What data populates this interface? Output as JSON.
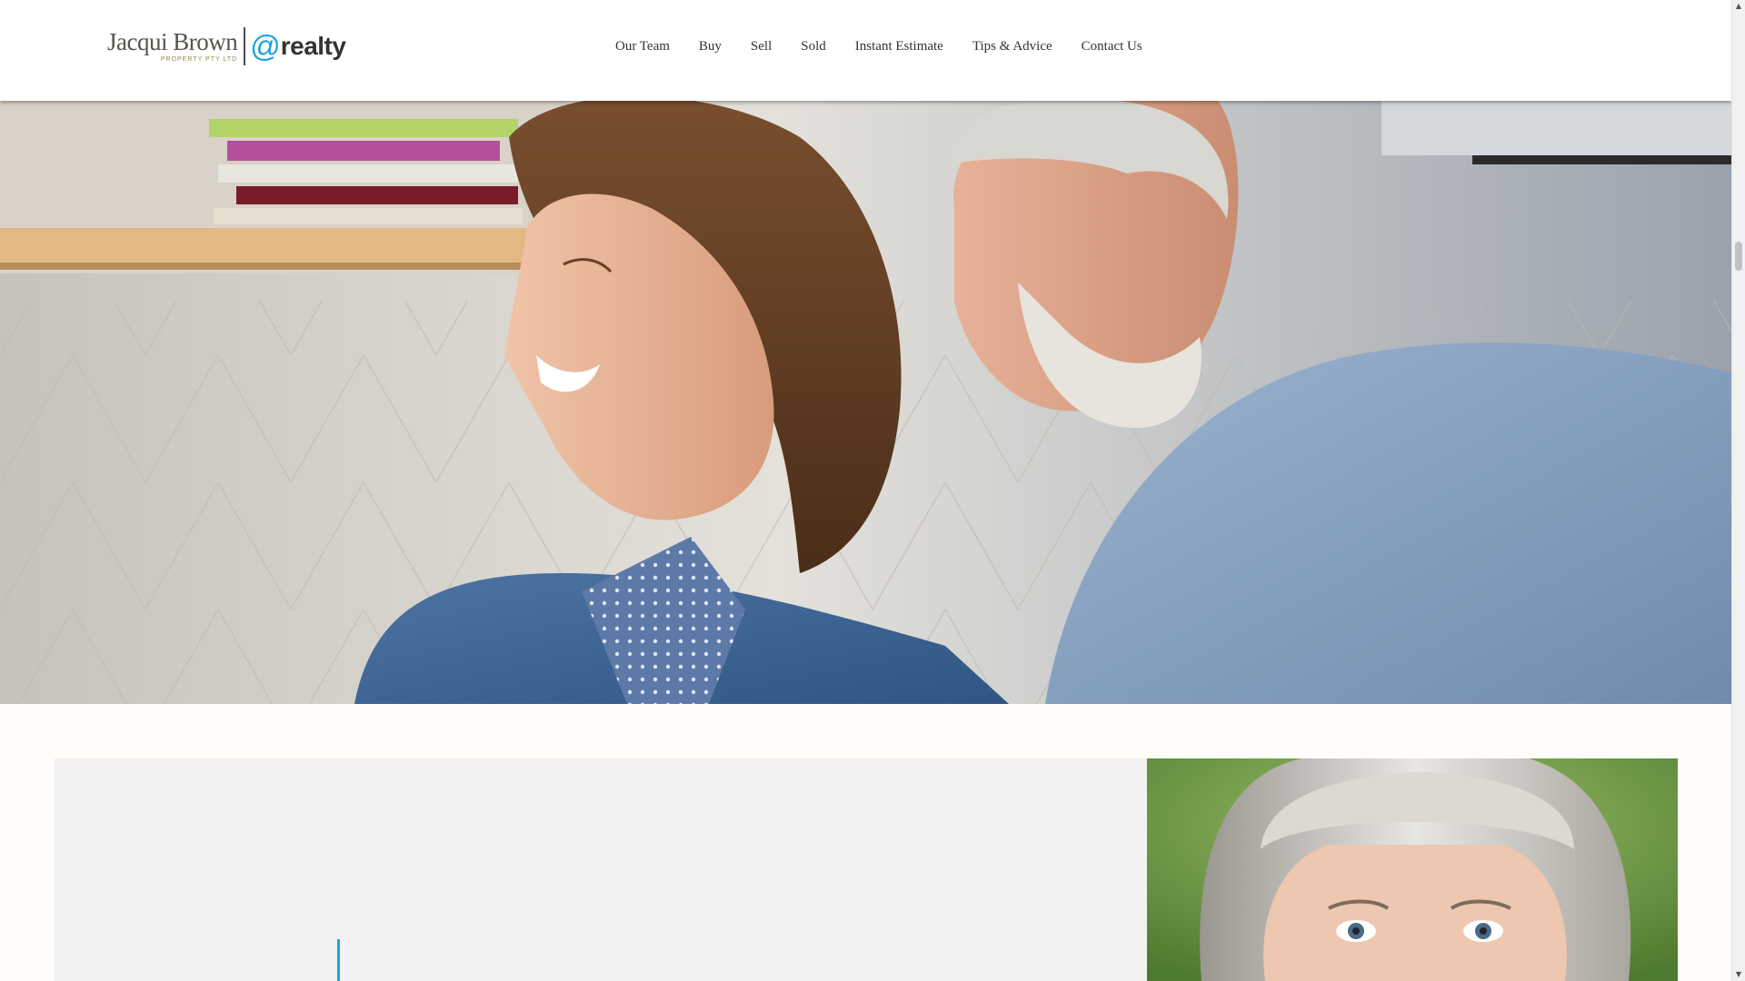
{
  "header": {
    "logo": {
      "name": "Jacqui Brown",
      "subtitle": "PROPERTY PTY LTD",
      "at": "@",
      "realty": "realty"
    },
    "nav": [
      {
        "label": "Our Team"
      },
      {
        "label": "Buy"
      },
      {
        "label": "Sell"
      },
      {
        "label": "Sold"
      },
      {
        "label": "Instant Estimate"
      },
      {
        "label": "Tips & Advice"
      },
      {
        "label": "Contact Us"
      }
    ]
  },
  "hero": {
    "image": "smiling-senior-couple-photo"
  },
  "feature": {
    "image": "grey-haired-woman-portrait-photo"
  },
  "colors": {
    "accent": "#1aa3d9",
    "page_background": "#fffcf9",
    "card_background": "#f2f2f2",
    "nav_text": "#333333"
  },
  "scrollbar": {
    "up_icon": "scroll-up-arrow-icon",
    "down_icon": "scroll-down-arrow-icon"
  }
}
